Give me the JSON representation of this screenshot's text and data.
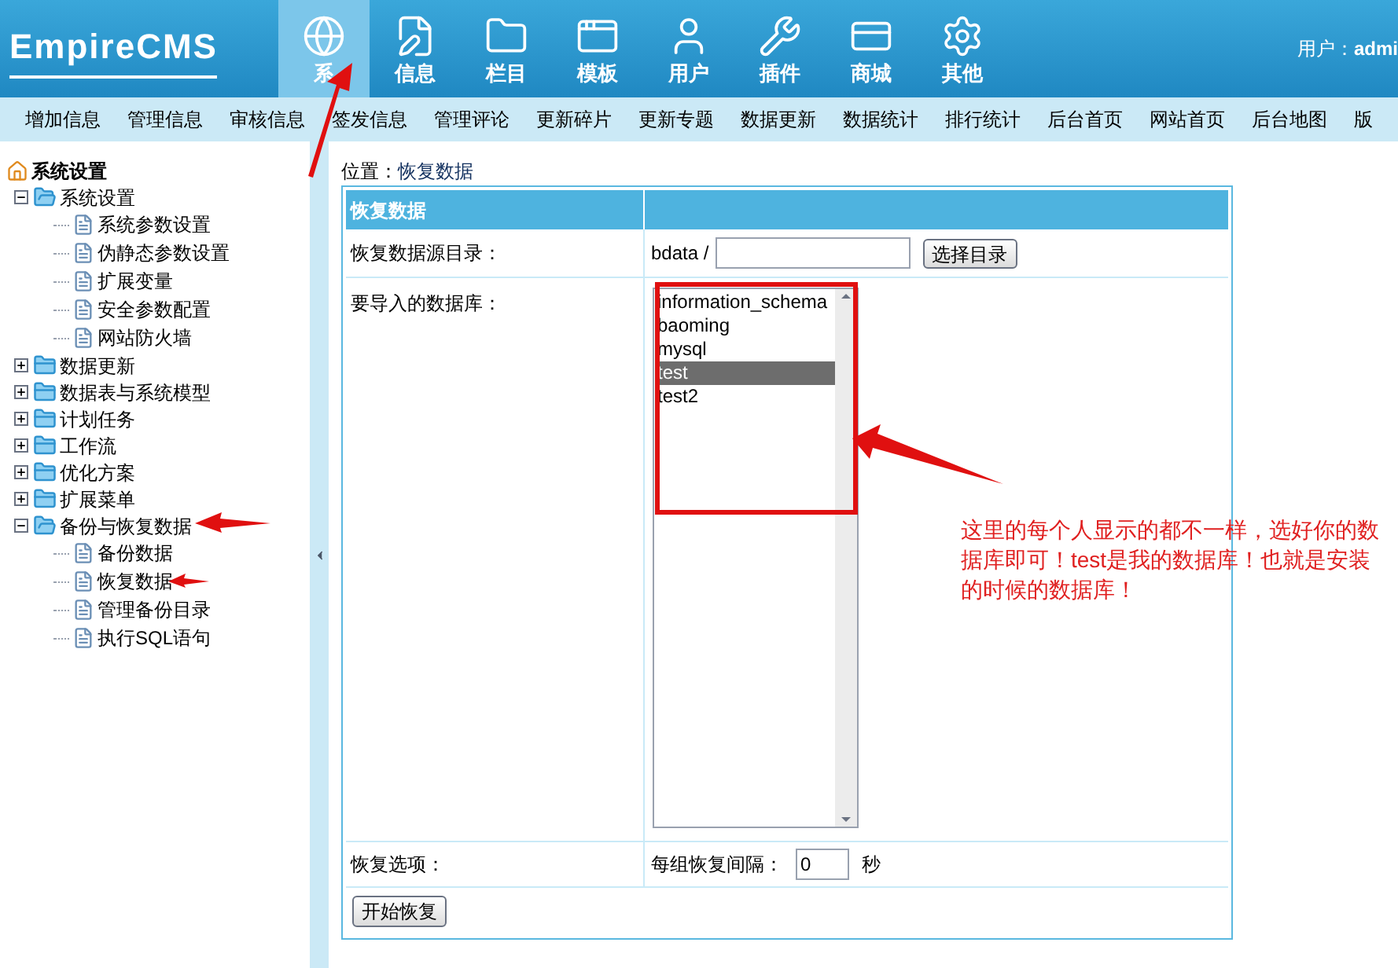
{
  "header": {
    "logo": "EmpireCMS",
    "nav": [
      {
        "label": "系",
        "selected": true
      },
      {
        "label": "信息",
        "selected": false
      },
      {
        "label": "栏目",
        "selected": false
      },
      {
        "label": "模板",
        "selected": false
      },
      {
        "label": "用户",
        "selected": false
      },
      {
        "label": "插件",
        "selected": false
      },
      {
        "label": "商城",
        "selected": false
      },
      {
        "label": "其他",
        "selected": false
      }
    ],
    "user_label": "用户：",
    "user_name": "admi"
  },
  "menu_bar": [
    "增加信息",
    "管理信息",
    "审核信息",
    "签发信息",
    "管理评论",
    "更新碎片",
    "更新专题",
    "数据更新",
    "数据统计",
    "排行统计",
    "后台首页",
    "网站首页",
    "后台地图",
    "版"
  ],
  "sidebar": {
    "title": "系统设置",
    "tree": [
      {
        "label": "系统设置",
        "expanded": true,
        "children": [
          {
            "label": "系统参数设置"
          },
          {
            "label": "伪静态参数设置"
          },
          {
            "label": "扩展变量"
          },
          {
            "label": "安全参数配置"
          },
          {
            "label": "网站防火墙"
          }
        ]
      },
      {
        "label": "数据更新",
        "expanded": false
      },
      {
        "label": "数据表与系统模型",
        "expanded": false
      },
      {
        "label": "计划任务",
        "expanded": false
      },
      {
        "label": "工作流",
        "expanded": false
      },
      {
        "label": "优化方案",
        "expanded": false
      },
      {
        "label": "扩展菜单",
        "expanded": false
      },
      {
        "label": "备份与恢复数据",
        "expanded": true,
        "children": [
          {
            "label": "备份数据"
          },
          {
            "label": "恢复数据"
          },
          {
            "label": "管理备份目录"
          },
          {
            "label": "执行SQL语句"
          }
        ]
      }
    ]
  },
  "breadcrumb": {
    "label": "位置：",
    "current": "恢复数据"
  },
  "form": {
    "title": "恢复数据",
    "source_dir": {
      "label": "恢复数据源目录：",
      "prefix": "bdata /",
      "button": "选择目录"
    },
    "database": {
      "label": "要导入的数据库：",
      "options": [
        {
          "label": "information_schema",
          "selected": false
        },
        {
          "label": "baoming",
          "selected": false
        },
        {
          "label": "mysql",
          "selected": false
        },
        {
          "label": "test",
          "selected": true
        },
        {
          "label": "test2",
          "selected": false
        }
      ]
    },
    "options": {
      "label": "恢复选项：",
      "interval_label": "每组恢复间隔：",
      "interval_value": "0",
      "unit": "秒"
    },
    "submit": "开始恢复"
  },
  "annotation": "这里的每个人显示的都不一样，选好你的数据库即可！test是我的数据库！也就是安装的时候的数据库！"
}
